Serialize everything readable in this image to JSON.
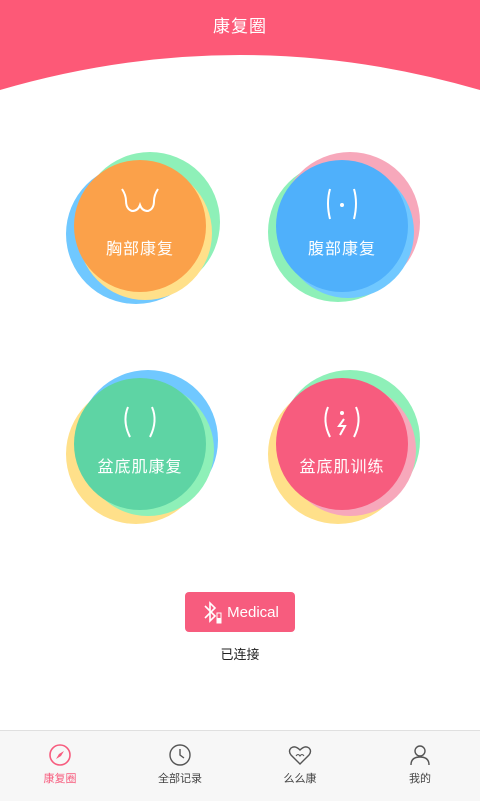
{
  "header": {
    "title": "康复圈"
  },
  "tiles": [
    {
      "label": "胸部康复",
      "icon": "chest-icon",
      "color": "#fba14a"
    },
    {
      "label": "腹部康复",
      "icon": "abdomen-icon",
      "color": "#4fb0fb"
    },
    {
      "label": "盆底肌康复",
      "icon": "pelvic-icon",
      "color": "#5ed4a4"
    },
    {
      "label": "盆底肌训练",
      "icon": "pelvic-training-icon",
      "color": "#f75c7e"
    }
  ],
  "device": {
    "icon": "bluetooth-icon",
    "label": "Medical",
    "status": "已连接"
  },
  "tabs": [
    {
      "label": "康复圈",
      "icon": "compass-icon",
      "active": true
    },
    {
      "label": "全部记录",
      "icon": "clock-icon",
      "active": false
    },
    {
      "label": "么么康",
      "icon": "heart-icon",
      "active": false
    },
    {
      "label": "我的",
      "icon": "person-icon",
      "active": false
    }
  ],
  "colors": {
    "accent": "#f75c7e",
    "ring_green": "#8ef0b8",
    "ring_blue": "#70c8ff",
    "ring_yellow": "#ffe08a",
    "ring_pink": "#f7a8bb"
  }
}
